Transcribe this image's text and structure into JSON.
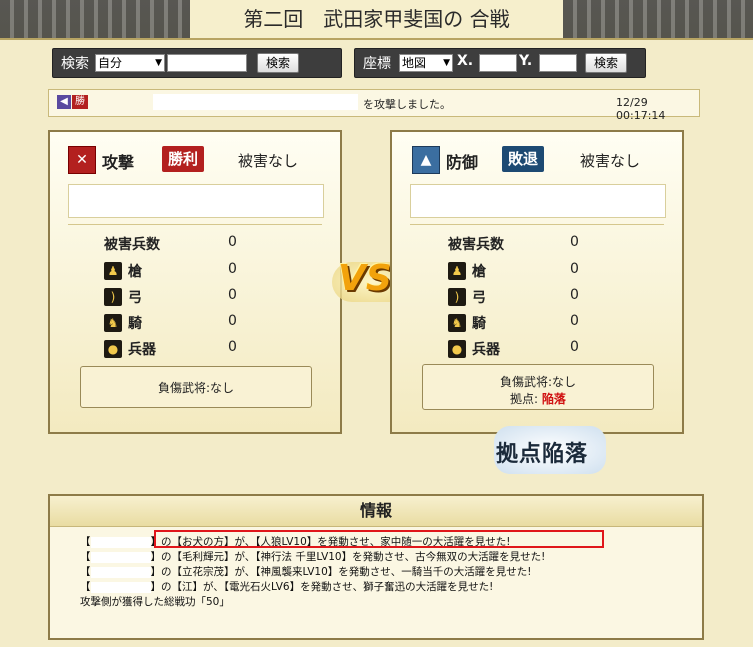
{
  "title": "第二回　武田家甲斐国の 合戦",
  "search_left": {
    "label": "検索",
    "select_value": "自分",
    "button": "検索"
  },
  "search_right": {
    "label": "座標",
    "select_value": "地図",
    "x_label": "X.",
    "y_label": "Y.",
    "button": "検索"
  },
  "message": {
    "badge": "勝",
    "text": "を攻撃しました。",
    "timestamp": "12/29 00:17:14"
  },
  "attack": {
    "label": "攻撃",
    "result": "勝利",
    "damage": "被害なし",
    "casualty": "負傷武将:なし"
  },
  "defense": {
    "label": "防御",
    "result": "敗退",
    "damage": "被害なし",
    "casualty": "負傷武将:なし",
    "base_label": "拠点:",
    "base_value": "陥落"
  },
  "stats": {
    "header": "被害兵数",
    "rows": [
      {
        "icon": "spear-icon",
        "label": "槍"
      },
      {
        "icon": "bow-icon",
        "label": "弓"
      },
      {
        "icon": "horse-icon",
        "label": "騎"
      },
      {
        "icon": "weapon-icon",
        "label": "兵器"
      }
    ],
    "attack_values": [
      "0",
      "0",
      "0",
      "0",
      "0"
    ],
    "defense_values": [
      "0",
      "0",
      "0",
      "0",
      "0"
    ]
  },
  "vs_text": "VS",
  "fallen_stamp": "拠点陥落",
  "info": {
    "title": "情報",
    "lines": [
      {
        "pre": "【",
        "post": "】の【お犬の方】が、【人狼LV10】を発動させ、家中随一の大活躍を見せた!"
      },
      {
        "pre": "【",
        "post": "】の【毛利輝元】が、【神行法 千里LV10】を発動させ、古今無双の大活躍を見せた!"
      },
      {
        "pre": "【",
        "post": "】の【立花宗茂】が、【神風襲来LV10】を発動させ、一騎当千の大活躍を見せた!"
      },
      {
        "pre": "【",
        "post": "】の【江】が、【電光石火LV6】を発動させ、獅子奮迅の大活躍を見せた!"
      }
    ],
    "footer": "攻撃側が獲得した総戦功「50」"
  },
  "colors": {
    "win_red": "#b3201f",
    "lose_blue": "#1d4a73",
    "highlight": "#e0161a",
    "fall_red": "#d01010"
  }
}
